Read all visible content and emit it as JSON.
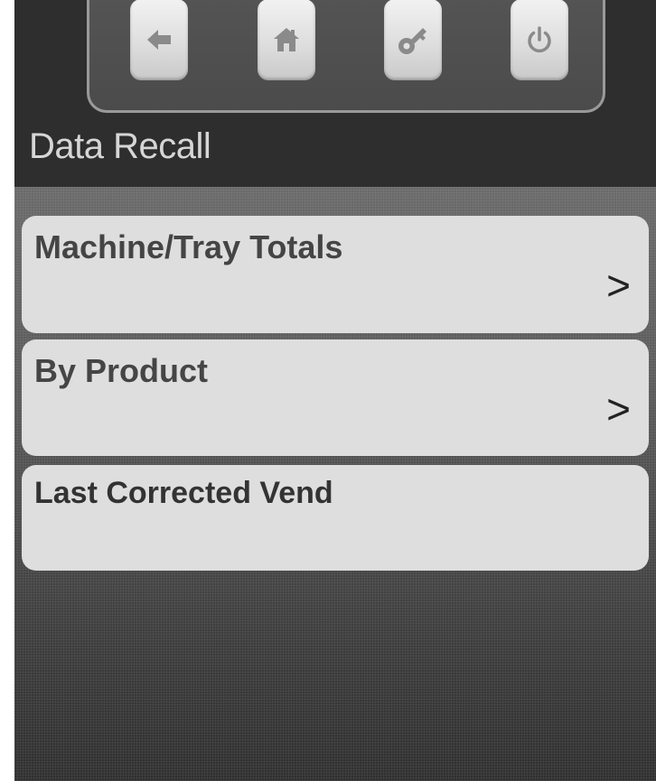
{
  "screen": {
    "title": "Data Recall"
  },
  "toolbar": {
    "buttons": [
      {
        "name": "back",
        "icon": "arrow-left-icon"
      },
      {
        "name": "home",
        "icon": "home-icon"
      },
      {
        "name": "key",
        "icon": "key-icon"
      },
      {
        "name": "power",
        "icon": "power-icon"
      }
    ],
    "icon_color": "#8a8a8a"
  },
  "menu": {
    "items": [
      {
        "label": "Machine/Tray Totals",
        "arrow": ">"
      },
      {
        "label": "By Product",
        "arrow": ">"
      },
      {
        "label": "Last Corrected Vend",
        "arrow": ""
      }
    ]
  },
  "colors": {
    "header_background": "#2e2e2e",
    "button_face": "#dedede",
    "title_text": "#d6d6d6"
  }
}
